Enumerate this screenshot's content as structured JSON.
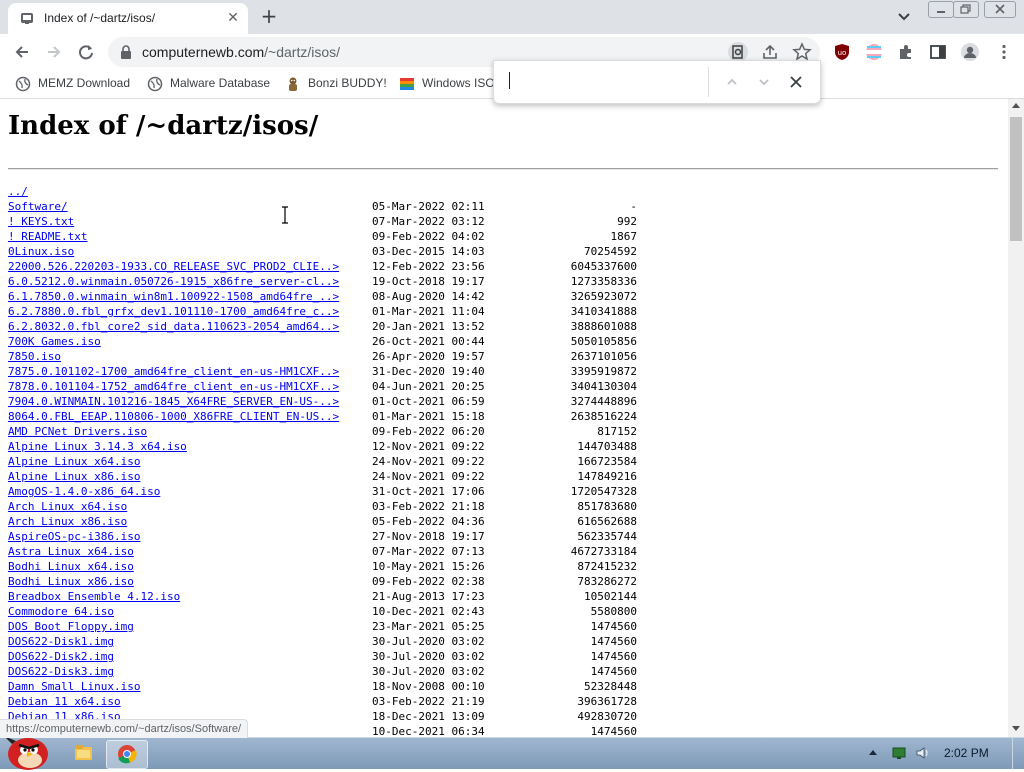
{
  "tab": {
    "title": "Index of /~dartz/isos/",
    "close_glyph": "✕",
    "new_tab_glyph": "+"
  },
  "window_controls": [
    "minimize",
    "maximize",
    "close"
  ],
  "omnibox": {
    "host": "computernewb.com",
    "path": "/~dartz/isos/"
  },
  "bookmarks": [
    {
      "label": "MEMZ Download",
      "icon": "globe-icon"
    },
    {
      "label": "Malware Database",
      "icon": "globe-icon"
    },
    {
      "label": "Bonzi BUDDY!",
      "icon": "bonzi-icon"
    },
    {
      "label": "Windows ISO",
      "icon": "windows-flag-icon"
    }
  ],
  "find_bar": {
    "query": ""
  },
  "page": {
    "heading": "Index of /~dartz/isos/",
    "entries": [
      {
        "name": "../",
        "date": "",
        "size": ""
      },
      {
        "name": "Software/",
        "date": "05-Mar-2022 02:11",
        "size": "-"
      },
      {
        "name": "! KEYS.txt",
        "date": "07-Mar-2022 03:12",
        "size": "992"
      },
      {
        "name": "! README.txt",
        "date": "09-Feb-2022 04:02",
        "size": "1867"
      },
      {
        "name": "0Linux.iso",
        "date": "03-Dec-2015 14:03",
        "size": "70254592"
      },
      {
        "name": "22000.526.220203-1933.CO_RELEASE_SVC_PROD2_CLIE..>",
        "date": "12-Feb-2022 23:56",
        "size": "6045337600"
      },
      {
        "name": "6.0.5212.0.winmain.050726-1915_x86fre_server-cl..>",
        "date": "19-Oct-2018 19:17",
        "size": "1273358336"
      },
      {
        "name": "6.1.7850.0.winmain_win8m1.100922-1508_amd64fre_..>",
        "date": "08-Aug-2020 14:42",
        "size": "3265923072"
      },
      {
        "name": "6.2.7880.0.fbl_grfx_dev1.101110-1700_amd64fre_c..>",
        "date": "01-Mar-2021 11:04",
        "size": "3410341888"
      },
      {
        "name": "6.2.8032.0.fbl_core2_sid_data.110623-2054_amd64..>",
        "date": "20-Jan-2021 13:52",
        "size": "3888601088"
      },
      {
        "name": "700K Games.iso",
        "date": "26-Oct-2021 00:44",
        "size": "5050105856"
      },
      {
        "name": "7850.iso",
        "date": "26-Apr-2020 19:57",
        "size": "2637101056"
      },
      {
        "name": "7875.0.101102-1700_amd64fre_client_en-us-HM1CXF..>",
        "date": "31-Dec-2020 19:40",
        "size": "3395919872"
      },
      {
        "name": "7878.0.101104-1752_amd64fre_client_en-us-HM1CXF..>",
        "date": "04-Jun-2021 20:25",
        "size": "3404130304"
      },
      {
        "name": "7904.0.WINMAIN.101216-1845_X64FRE_SERVER_EN-US-..>",
        "date": "01-Oct-2021 06:59",
        "size": "3274448896"
      },
      {
        "name": "8064.0.FBL_EEAP.110806-1000_X86FRE_CLIENT_EN-US..>",
        "date": "01-Mar-2021 15:18",
        "size": "2638516224"
      },
      {
        "name": "AMD PCNet Drivers.iso",
        "date": "09-Feb-2022 06:20",
        "size": "817152"
      },
      {
        "name": "Alpine Linux 3.14.3 x64.iso",
        "date": "12-Nov-2021 09:22",
        "size": "144703488"
      },
      {
        "name": "Alpine Linux x64.iso",
        "date": "24-Nov-2021 09:22",
        "size": "166723584"
      },
      {
        "name": "Alpine Linux x86.iso",
        "date": "24-Nov-2021 09:22",
        "size": "147849216"
      },
      {
        "name": "AmogOS-1.4.0-x86_64.iso",
        "date": "31-Oct-2021 17:06",
        "size": "1720547328"
      },
      {
        "name": "Arch Linux x64.iso",
        "date": "03-Feb-2022 21:18",
        "size": "851783680"
      },
      {
        "name": "Arch Linux x86.iso",
        "date": "05-Feb-2022 04:36",
        "size": "616562688"
      },
      {
        "name": "AspireOS-pc-i386.iso",
        "date": "27-Nov-2018 19:17",
        "size": "562335744"
      },
      {
        "name": "Astra Linux x64.iso",
        "date": "07-Mar-2022 07:13",
        "size": "4672733184"
      },
      {
        "name": "Bodhi Linux x64.iso",
        "date": "10-May-2021 15:26",
        "size": "872415232"
      },
      {
        "name": "Bodhi Linux x86.iso",
        "date": "09-Feb-2022 02:38",
        "size": "783286272"
      },
      {
        "name": "Breadbox Ensemble 4.12.iso",
        "date": "21-Aug-2013 17:23",
        "size": "10502144"
      },
      {
        "name": "Commodore 64.iso",
        "date": "10-Dec-2021 02:43",
        "size": "5580800"
      },
      {
        "name": "DOS Boot Floppy.img",
        "date": "23-Mar-2021 05:25",
        "size": "1474560"
      },
      {
        "name": "DOS622-Disk1.img",
        "date": "30-Jul-2020 03:02",
        "size": "1474560"
      },
      {
        "name": "DOS622-Disk2.img",
        "date": "30-Jul-2020 03:02",
        "size": "1474560"
      },
      {
        "name": "DOS622-Disk3.img",
        "date": "30-Jul-2020 03:02",
        "size": "1474560"
      },
      {
        "name": "Damn Small Linux.iso",
        "date": "18-Nov-2008 00:10",
        "size": "52328448"
      },
      {
        "name": "Debian 11 x64.iso",
        "date": "03-Feb-2022 21:19",
        "size": "396361728"
      },
      {
        "name": "Debian 11 x86.iso",
        "date": "18-Dec-2021 13:09",
        "size": "492830720"
      },
      {
        "name": "",
        "date": "10-Dec-2021 06:34",
        "size": "1474560"
      }
    ]
  },
  "status_bubble": "https://computernewb.com/~dartz/isos/Software/",
  "taskbar": {
    "clock": "2:02 PM"
  },
  "colors": {
    "link": "#0000ee",
    "tab_strip": "#dee1e6",
    "omnibox": "#f1f3f4",
    "taskbar": "#7e9ab8"
  }
}
